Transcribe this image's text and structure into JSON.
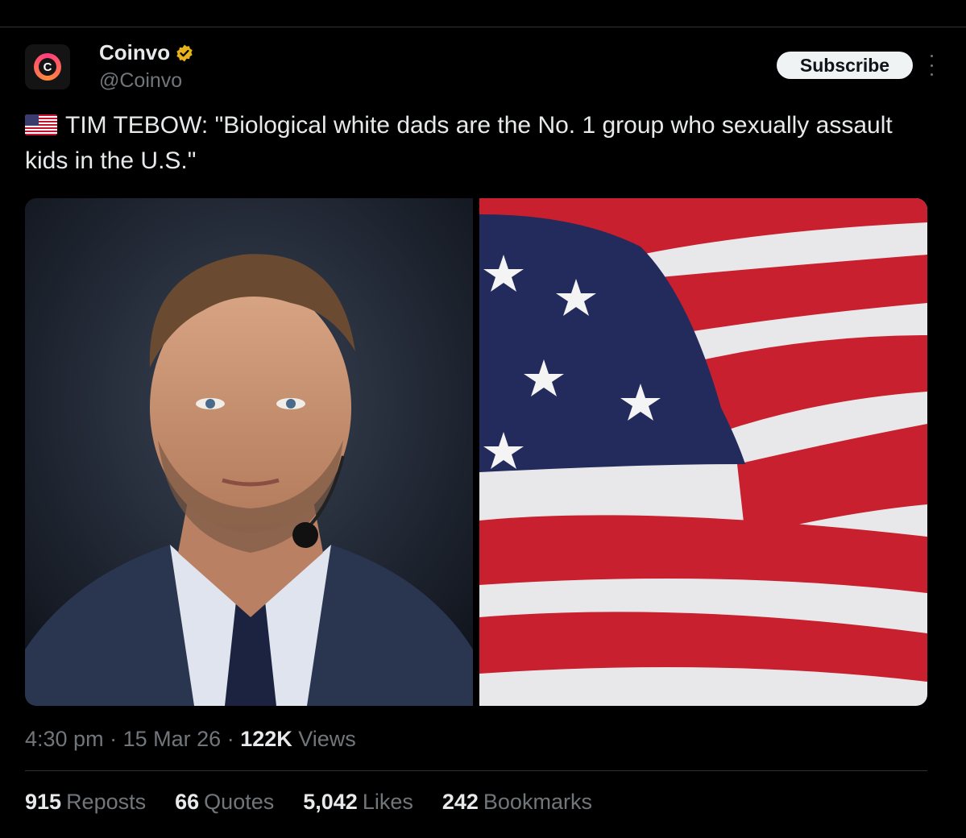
{
  "account": {
    "display_name": "Coinvo",
    "handle": "@Coinvo",
    "avatar_letter": "C",
    "verified_color": "#e8b21a"
  },
  "actions": {
    "subscribe_label": "Subscribe"
  },
  "tweet": {
    "text": "TIM TEBOW: \"Biological white dads are the No. 1 group who sexually assault kids in the U.S.\""
  },
  "meta": {
    "time": "4:30 pm",
    "date": "15 Mar 26",
    "views_count": "122K",
    "views_label": "Views",
    "separator": "·"
  },
  "stats": [
    {
      "count": "915",
      "label": "Reposts"
    },
    {
      "count": "66",
      "label": "Quotes"
    },
    {
      "count": "5,042",
      "label": "Likes"
    },
    {
      "count": "242",
      "label": "Bookmarks"
    }
  ],
  "colors": {
    "background": "#000000",
    "text_primary": "#e7e9ea",
    "text_secondary": "#71767b",
    "divider": "#2f3336"
  }
}
